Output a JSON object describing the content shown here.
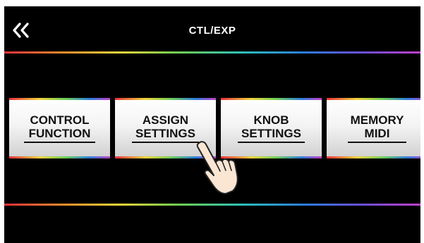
{
  "header": {
    "title": "CTL/EXP",
    "back_icon": "double-chevron-left-icon"
  },
  "buttons": [
    {
      "line1": "CONTROL",
      "line2": "FUNCTION"
    },
    {
      "line1": "ASSIGN",
      "line2": "SETTINGS"
    },
    {
      "line1": "KNOB",
      "line2": "SETTINGS"
    },
    {
      "line1": "MEMORY",
      "line2": "MIDI"
    }
  ],
  "colors": {
    "background": "#000000",
    "title_text": "#ffffff",
    "button_text": "#111111"
  },
  "pointer_icon": "pointing-hand-icon"
}
